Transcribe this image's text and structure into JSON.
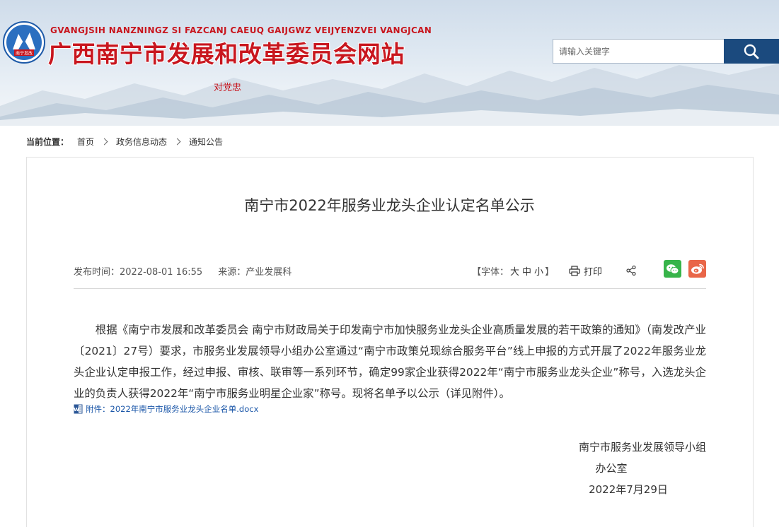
{
  "header": {
    "pinyin": "GVANGJSIH NANZNINGZ SI FAZCANJ CAEUQ GAIJGWZ VEIJYENZVEI VANGJCAN",
    "title": "广西南宁市发展和改革委员会网站",
    "logo_text": "南宁发改",
    "link": "对党忠",
    "search_placeholder": "请输入关键字",
    "colors": {
      "brand_red": "#c8161e",
      "search_button": "#1b4a7e"
    }
  },
  "breadcrumb": {
    "label": "当前位置：",
    "items": [
      "首页",
      "政务信息动态",
      "通知公告"
    ]
  },
  "article": {
    "title": "南宁市2022年服务业龙头企业认定名单公示",
    "publish_time": "发布时间：2022-08-01 16:55",
    "source": "来源：产业发展科",
    "font_label_open": "【字体：",
    "font_large": "大",
    "font_medium": "中",
    "font_small": "小",
    "font_label_close": "】",
    "print_label": "打印",
    "body": "根据《南宁市发展和改革委员会 南宁市财政局关于印发南宁市加快服务业龙头企业高质量发展的若干政策的通知》（南发改产业〔2021〕27号）要求，市服务业发展领导小组办公室通过“南宁市政策兑现综合服务平台”线上申报的方式开展了2022年服务业龙头企业认定申报工作，经过申报、审核、联审等一系列环节，确定99家企业获得2022年“南宁市服务业龙头企业”称号，入选龙头企业的负责人获得2022年“南宁市服务业明星企业家”称号。现将名单予以公示（详见附件）。",
    "attachment": "附件：2022年南宁市服务业龙头企业名单.docx",
    "signature_org": "南宁市服务业发展领导小组",
    "signature_office": "办公室",
    "signature_date": "2022年7月29日"
  },
  "icons": [
    "emblem-logo-icon",
    "search-icon",
    "chevron-right-icon",
    "printer-icon",
    "share-icon",
    "wechat-icon",
    "weibo-icon",
    "word-document-icon"
  ]
}
